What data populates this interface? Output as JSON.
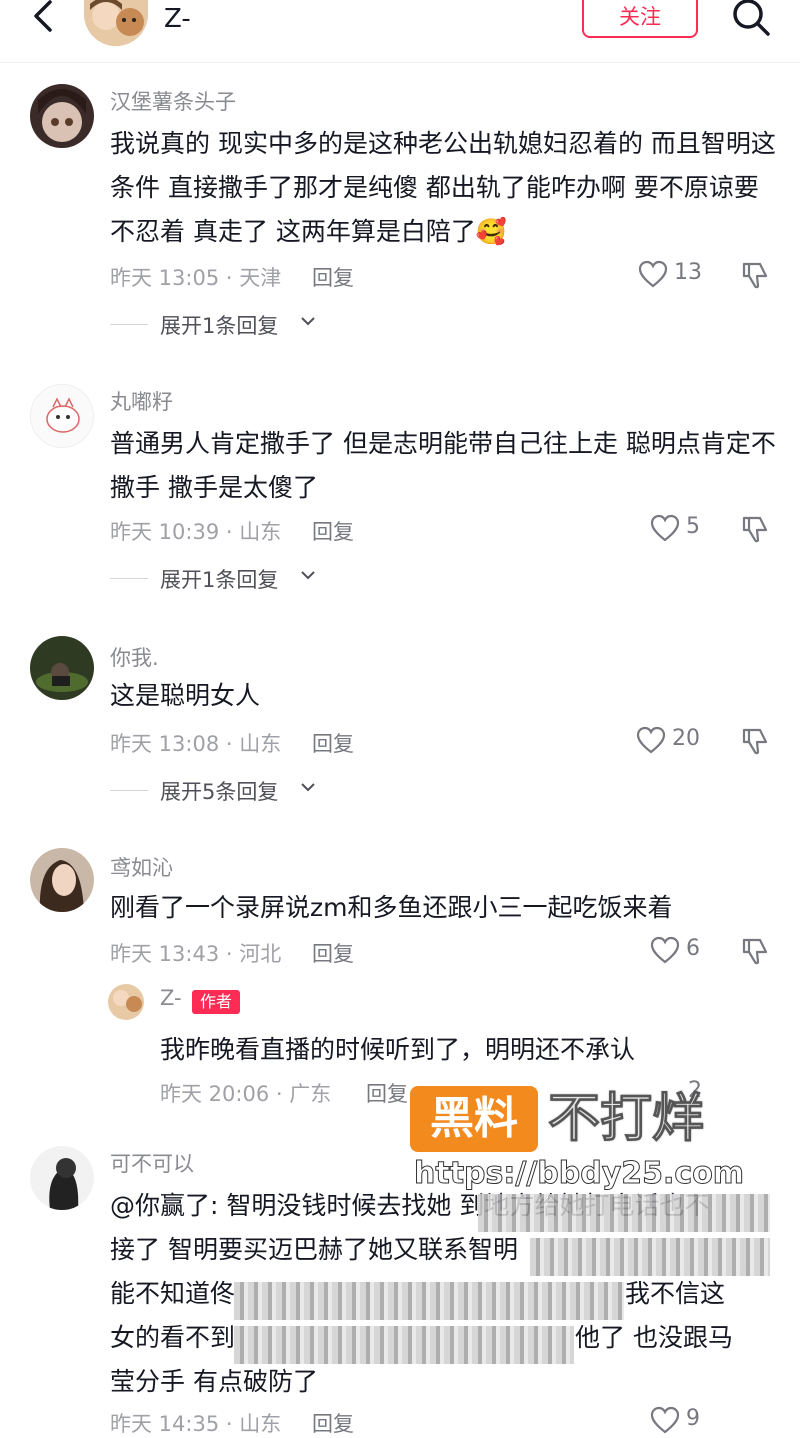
{
  "header": {
    "author_name": "Z-",
    "follow_label": "关注"
  },
  "comments": [
    {
      "username": "汉堡薯条头子",
      "text": "我说真的 现实中多的是这种老公出轨媳妇忍着的 而且智明这条件 直接撒手了那才是纯傻 都出轨了能咋办啊 要不原谅要不忍着 真走了 这两年算是白陪了🥰",
      "meta": "昨天 13:05 · 天津",
      "reply_label": "回复",
      "likes": "13",
      "expand_label": "展开1条回复"
    },
    {
      "username": "丸嘟籽",
      "text": "普通男人肯定撒手了 但是志明能带自己往上走 聪明点肯定不撒手 撒手是太傻了",
      "meta": "昨天 10:39 · 山东",
      "reply_label": "回复",
      "likes": "5",
      "expand_label": "展开1条回复"
    },
    {
      "username": "你我.",
      "text": "这是聪明女人",
      "meta": "昨天 13:08 · 山东",
      "reply_label": "回复",
      "likes": "20",
      "expand_label": "展开5条回复"
    },
    {
      "username": "鸢如沁",
      "text": "刚看了一个录屏说zm和多鱼还跟小三一起吃饭来着",
      "meta": "昨天 13:43 · 河北",
      "reply_label": "回复",
      "likes": "6"
    },
    {
      "username": "可不可以",
      "text_line1": "@你赢了: 智明没钱时候去找她 到地方给她打电话也不",
      "text_line2": "接了 智明要买迈巴赫了她又联系智明",
      "text_line3": "能不知道佟",
      "text_line3b": "我不信这",
      "text_line4a": "女的看不到",
      "text_line4b": "他了 也没跟马",
      "text_line5": "莹分手 有点破防了",
      "meta": "昨天 14:35 · 山东",
      "reply_label": "回复",
      "likes": "9"
    }
  ],
  "author_reply": {
    "username": "Z-",
    "tag": "作者",
    "text": "我昨晚看直播的时候听到了，明明还不承认",
    "meta": "昨天 20:06 · 广东",
    "reply_label": "回复",
    "likes": "2"
  },
  "watermark": {
    "badge": "黑料",
    "text": "不打烊",
    "url": "https://bbdy25.com"
  }
}
